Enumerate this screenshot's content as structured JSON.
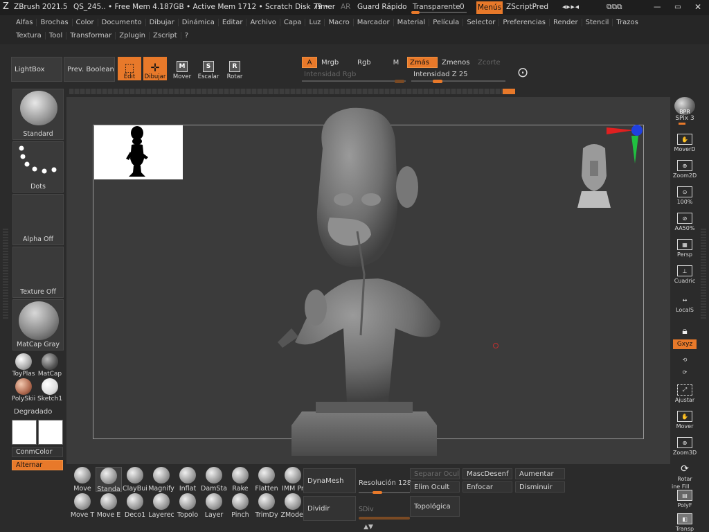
{
  "titlebar": {
    "app_title": "ZBrush 2021.5",
    "file": "QS_245",
    "mem_status": ".. • Free Mem 4.187GB • Active Mem 1712 • Scratch Disk 79 •",
    "timer": "Timer",
    "ar": "AR",
    "quicksave": "Guard Rápido",
    "transparent": "Transparente",
    "transparent_value": "0",
    "menus": "Menús",
    "zscript_pred": "ZScriptPred"
  },
  "menus": {
    "row1": [
      "Alfas",
      "Brochas",
      "Color",
      "Documento",
      "Dibujar",
      "Dinámica",
      "Editar",
      "Archivo",
      "Capa",
      "Luz",
      "Macro",
      "Marcador",
      "Material",
      "Película",
      "Selector",
      "Preferencias",
      "Render",
      "Stencil",
      "Trazos"
    ],
    "row2": [
      "Textura",
      "Tool",
      "Transformar",
      "Zplugin",
      "Zscript",
      "?"
    ]
  },
  "toolbar": {
    "lightbox": "LightBox",
    "prev_boolean": "Prev. Booleana",
    "edit": "Edit",
    "draw": "Dibujar",
    "move": "Mover",
    "scale": "Escalar",
    "rotate": "Rotar",
    "a": "A",
    "mrgb": "Mrgb",
    "rgb": "Rgb",
    "m": "M",
    "zadd": "Zmás",
    "zsub": "Zmenos",
    "zcut": "Zcorte",
    "rgb_intensity": "Intensidad Rgb",
    "z_intensity": "Intensidad Z 25",
    "z_intensity_fill": 0.25
  },
  "left": {
    "brush": "Standard",
    "stroke": "Dots",
    "alpha": "Alpha Off",
    "texture": "Texture Off",
    "material": "MatCap Gray",
    "materials": [
      "ToyPlas",
      "MatCap",
      "PolySkii",
      "Sketch1"
    ],
    "gradient": "Degradado",
    "conmcolor": "ConmColor",
    "switch": "Alternar"
  },
  "right": {
    "bpr": "BPR",
    "spix": "SPix 3",
    "items": [
      "MoverD",
      "Zoom2D",
      "100%",
      "AA50%",
      "Persp",
      "Cuadric",
      "LocalS",
      "",
      "Gxyz",
      "",
      "",
      "Ajustar",
      "Mover",
      "Zoom3D",
      "Rotar",
      "PolyF",
      "Transp"
    ],
    "line_fill": "ine Fill"
  },
  "brushes": {
    "row1": [
      "Move",
      "Standa",
      "ClayBui",
      "Magnify",
      "Inflat",
      "DamSta",
      "Rake",
      "Flatten",
      "IMM Pr"
    ],
    "row2": [
      "Move T",
      "Move E",
      "Deco1",
      "Layerec",
      "Topolo",
      "Layer",
      "Pinch",
      "TrimDy",
      "ZModel"
    ]
  },
  "geometry": {
    "dynamesh": "DynaMesh",
    "resolution": "Resolución 128",
    "divide": "Dividir",
    "sdiv": "SDiv",
    "topological": "Topológica",
    "split_hidden": "Separar Ocult",
    "del_hidden": "Elim Ocult",
    "mask_unmask": "MascDesenf",
    "focus": "Enfocar",
    "grow": "Aumentar",
    "shrink": "Disminuir"
  },
  "colors": {
    "accent": "#e8792a",
    "bg": "#2b2b2b",
    "canvas": "#3b3b3b"
  }
}
